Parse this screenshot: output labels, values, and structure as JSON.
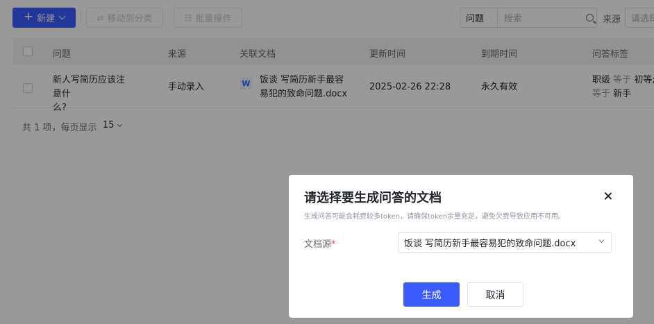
{
  "toolbar": {
    "new_label": "新建",
    "move_label": "移动到分类",
    "batch_label": "批量操作",
    "filter_field": "问题",
    "search_placeholder": "搜索",
    "source_label": "来源",
    "source_placeholder": "请选择"
  },
  "table": {
    "columns": [
      "问题",
      "来源",
      "关联文档",
      "更新时间",
      "到期时间",
      "问答标签"
    ],
    "rows": [
      {
        "question_line1": "新人写简历应该注意什",
        "question_line2": "么?",
        "source": "手动录入",
        "doc_line1": "饭谈 写简历新手最容",
        "doc_line2": "易犯的致命问题.docx",
        "updated": "2025-02-26 22:28",
        "expires": "永久有效",
        "tag_key1": "职级",
        "tag_op1": "等于",
        "tag_val1": "初等;",
        "tag_op2": "等于",
        "tag_val2": "新手"
      }
    ]
  },
  "pager": {
    "summary": "共 1 项，每页显示",
    "page_size": "15"
  },
  "dialog": {
    "title": "请选择要生成问答的文档",
    "tip": "生成问答可能会耗费较多token，请确保token余量充足，避免欠费导致应用不可用。",
    "source_label": "文档源",
    "required_mark": "*",
    "source_value": "饭谈 写简历新手最容易犯的致命问题.docx",
    "confirm_label": "生成",
    "cancel_label": "取消"
  },
  "colors": {
    "primary": "#3b5bff",
    "overlay": "rgba(0,0,0,0.40)"
  }
}
